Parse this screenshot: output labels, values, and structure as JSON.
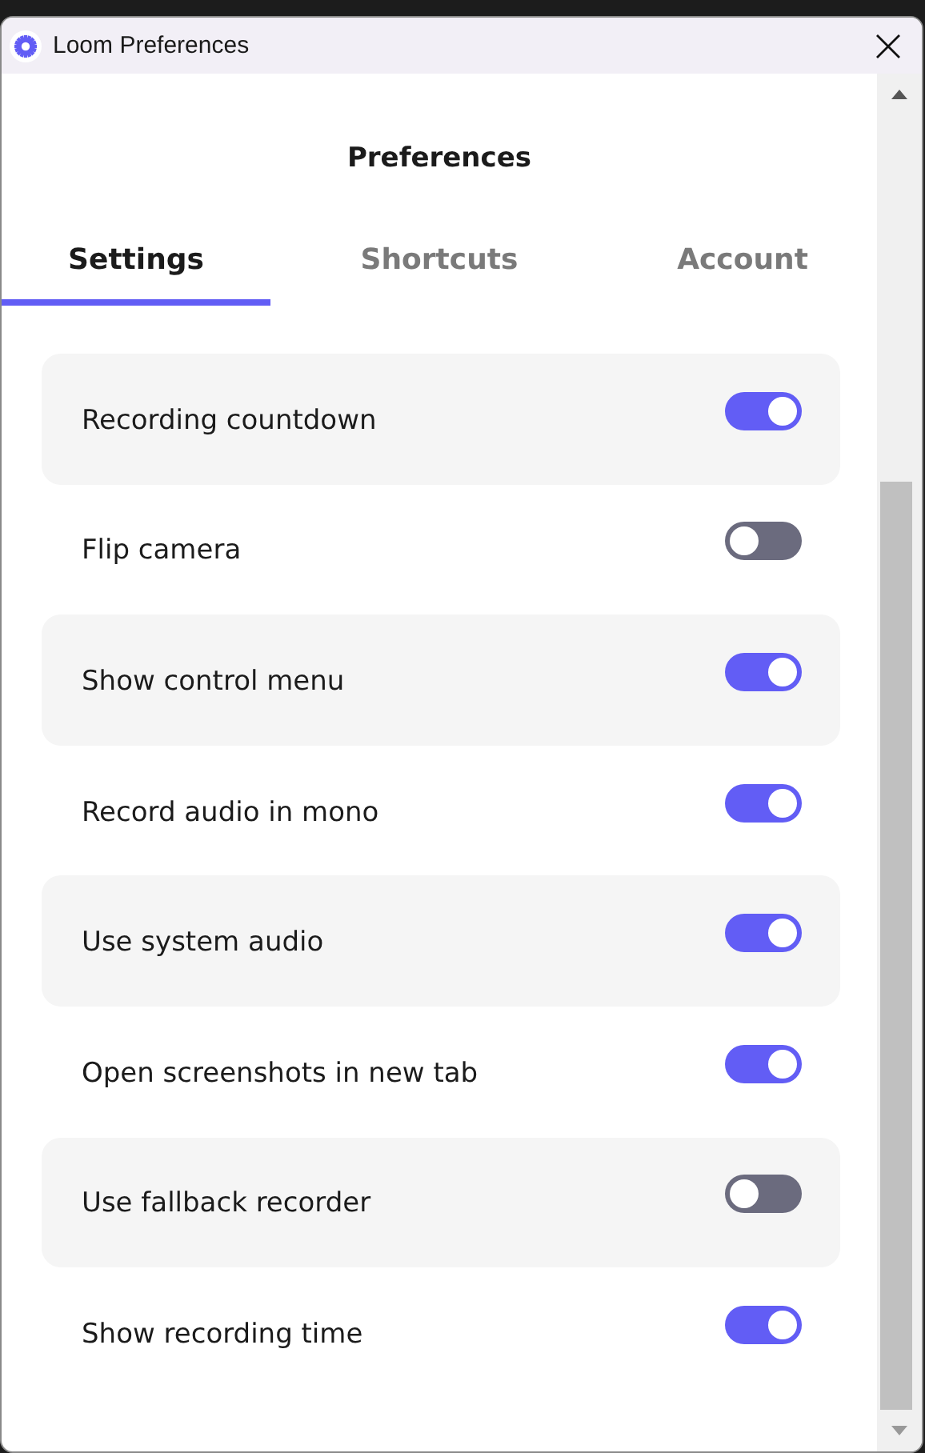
{
  "window": {
    "title": "Loom Preferences"
  },
  "heading": "Preferences",
  "tabs": [
    {
      "label": "Settings",
      "selected": true
    },
    {
      "label": "Shortcuts",
      "selected": false
    },
    {
      "label": "Account",
      "selected": false
    }
  ],
  "settings": [
    {
      "label": "Recording countdown",
      "on": true
    },
    {
      "label": "Flip camera",
      "on": false
    },
    {
      "label": "Show control menu",
      "on": true
    },
    {
      "label": "Record audio in mono",
      "on": true
    },
    {
      "label": "Use system audio",
      "on": true
    },
    {
      "label": "Open screenshots in new tab",
      "on": true
    },
    {
      "label": "Use fallback recorder",
      "on": false
    },
    {
      "label": "Show recording time",
      "on": true
    }
  ]
}
